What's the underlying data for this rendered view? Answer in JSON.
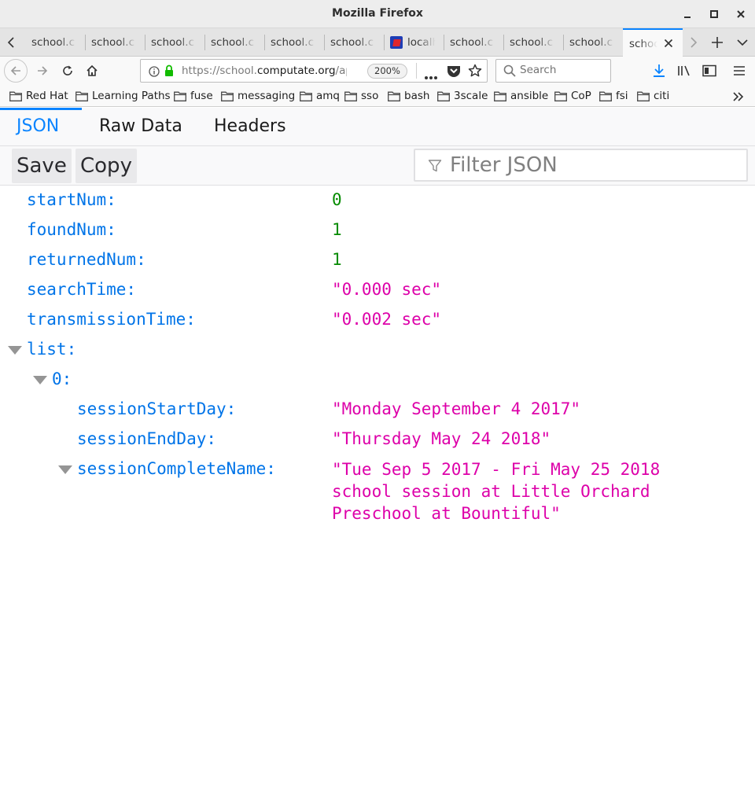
{
  "window": {
    "title": "Mozilla Firefox"
  },
  "tabs": [
    {
      "label": "school.c"
    },
    {
      "label": "school.c"
    },
    {
      "label": "school.c"
    },
    {
      "label": "school.c"
    },
    {
      "label": "school.c"
    },
    {
      "label": "school.c"
    },
    {
      "label": "localh"
    },
    {
      "label": "school.c"
    },
    {
      "label": "school.c"
    },
    {
      "label": "school.c"
    },
    {
      "label": "schoo"
    }
  ],
  "navbar": {
    "url_prefix": "https://school.",
    "url_domain": "computate.org",
    "url_suffix": "/ap",
    "zoom": "200%",
    "search_placeholder": "Search"
  },
  "bookmarks": [
    "Red Hat",
    "Learning Paths",
    "fuse",
    "messaging",
    "amq",
    "sso",
    "bash",
    "3scale",
    "ansible",
    "CoP",
    "fsi",
    "citi"
  ],
  "viewer": {
    "tabs": {
      "json": "JSON",
      "raw": "Raw Data",
      "headers": "Headers"
    },
    "toolbar": {
      "save": "Save",
      "copy": "Copy",
      "filter_placeholder": "Filter JSON"
    }
  },
  "json": {
    "startNum": {
      "key": "startNum:",
      "value": "0"
    },
    "foundNum": {
      "key": "foundNum:",
      "value": "1"
    },
    "returnedNum": {
      "key": "returnedNum:",
      "value": "1"
    },
    "searchTime": {
      "key": "searchTime:",
      "value": "\"0.000 sec\""
    },
    "transmissionTime": {
      "key": "transmissionTime:",
      "value": "\"0.002 sec\""
    },
    "list": {
      "key": "list:"
    },
    "item0": {
      "key": "0:"
    },
    "sessionStartDay": {
      "key": "sessionStartDay:",
      "value": "\"Monday September 4 2017\""
    },
    "sessionEndDay": {
      "key": "sessionEndDay:",
      "value": "\"Thursday May 24 2018\""
    },
    "sessionCompleteName": {
      "key": "sessionCompleteName:",
      "value": "\"Tue Sep 5 2017 - Fri May 25 2018 school session at Little Orchard Preschool at Bountiful\""
    }
  }
}
